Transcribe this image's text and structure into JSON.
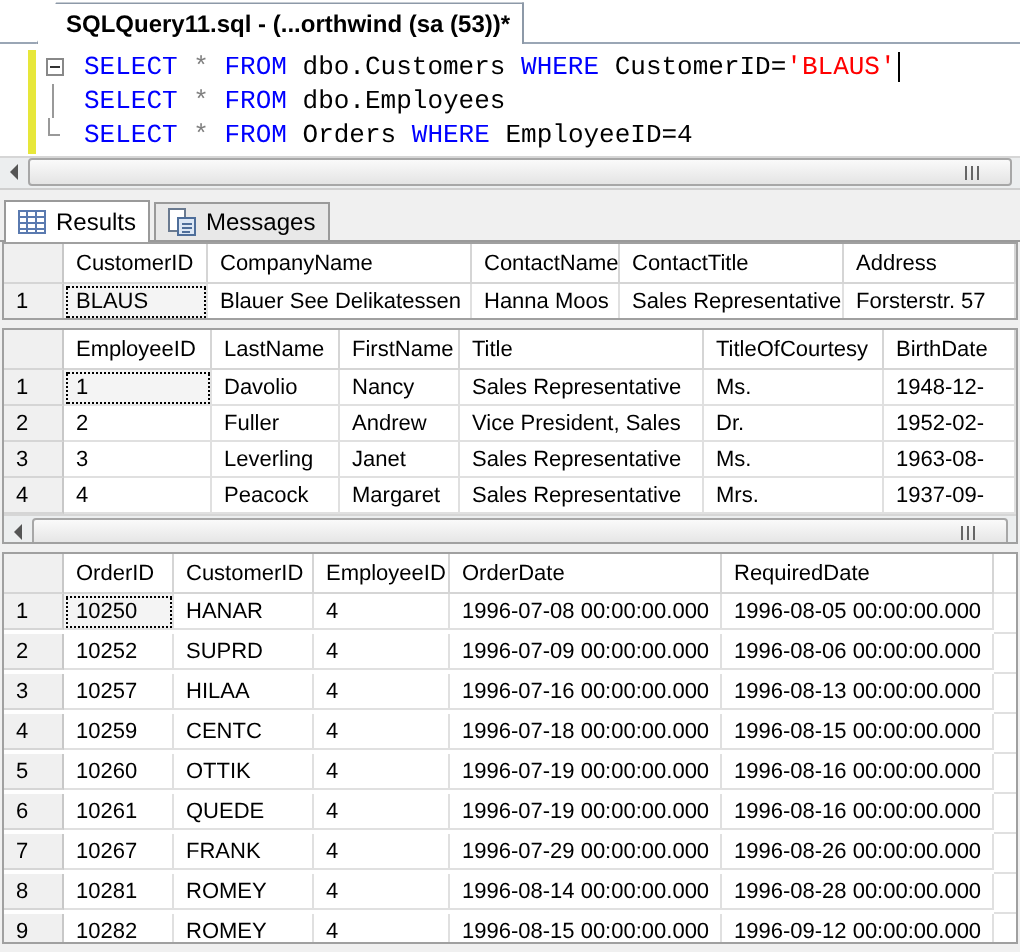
{
  "editor": {
    "tab": {
      "title": "SQLQuery11.sql - (...orthwind (sa (53))*",
      "selected": true
    },
    "lines": [
      {
        "tokens": [
          {
            "kind": "keyword",
            "text": "SELECT"
          },
          {
            "kind": "operator",
            "text": "*"
          },
          {
            "kind": "keyword",
            "text": "FROM"
          },
          {
            "kind": "plain",
            "text": "dbo.Customers"
          },
          {
            "kind": "keyword",
            "text": "WHERE"
          },
          {
            "kind": "plain",
            "text": "CustomerID="
          },
          {
            "kind": "string",
            "text": "'BLAUS'",
            "spaced": false
          }
        ],
        "caret": true
      },
      {
        "tokens": [
          {
            "kind": "keyword",
            "text": "SELECT"
          },
          {
            "kind": "operator",
            "text": "*"
          },
          {
            "kind": "keyword",
            "text": "FROM"
          },
          {
            "kind": "plain",
            "text": "dbo.Employees"
          }
        ],
        "caret": false
      },
      {
        "tokens": [
          {
            "kind": "keyword",
            "text": "SELECT"
          },
          {
            "kind": "operator",
            "text": "*"
          },
          {
            "kind": "keyword",
            "text": "FROM"
          },
          {
            "kind": "plain",
            "text": "Orders"
          },
          {
            "kind": "keyword",
            "text": "WHERE"
          },
          {
            "kind": "plain",
            "text": "EmployeeID=4"
          }
        ],
        "caret": false
      }
    ]
  },
  "result_tabs": [
    {
      "label": "Results",
      "selected": true,
      "kind": "grid"
    },
    {
      "label": "Messages",
      "selected": false,
      "kind": "messages"
    }
  ],
  "grids": [
    {
      "columns": [
        "CustomerID",
        "CompanyName",
        "ContactName",
        "ContactTitle",
        "Address"
      ],
      "scrollbar": false,
      "rows": [
        {
          "number": "1",
          "focused": true,
          "cells": [
            "BLAUS",
            "Blauer See Delikatessen",
            "Hanna Moos",
            "Sales Representative",
            "Forsterstr. 57"
          ]
        }
      ]
    },
    {
      "columns": [
        "EmployeeID",
        "LastName",
        "FirstName",
        "Title",
        "TitleOfCourtesy",
        "BirthDate"
      ],
      "scrollbar": true,
      "rows": [
        {
          "number": "1",
          "focused": true,
          "cells": [
            "1",
            "Davolio",
            "Nancy",
            "Sales Representative",
            "Ms.",
            "1948-12-"
          ]
        },
        {
          "number": "2",
          "focused": false,
          "cells": [
            "2",
            "Fuller",
            "Andrew",
            "Vice President, Sales",
            "Dr.",
            "1952-02-"
          ]
        },
        {
          "number": "3",
          "focused": false,
          "cells": [
            "3",
            "Leverling",
            "Janet",
            "Sales Representative",
            "Ms.",
            "1963-08-"
          ]
        },
        {
          "number": "4",
          "focused": false,
          "cells": [
            "4",
            "Peacock",
            "Margaret",
            "Sales Representative",
            "Mrs.",
            "1937-09-"
          ]
        }
      ]
    },
    {
      "columns": [
        "OrderID",
        "CustomerID",
        "EmployeeID",
        "OrderDate",
        "RequiredDate"
      ],
      "scrollbar": false,
      "rows": [
        {
          "number": "1",
          "focused": true,
          "cells": [
            "10250",
            "HANAR",
            "4",
            "1996-07-08 00:00:00.000",
            "1996-08-05 00:00:00.000"
          ]
        },
        {
          "number": "2",
          "focused": false,
          "cells": [
            "10252",
            "SUPRD",
            "4",
            "1996-07-09 00:00:00.000",
            "1996-08-06 00:00:00.000"
          ]
        },
        {
          "number": "3",
          "focused": false,
          "cells": [
            "10257",
            "HILAA",
            "4",
            "1996-07-16 00:00:00.000",
            "1996-08-13 00:00:00.000"
          ]
        },
        {
          "number": "4",
          "focused": false,
          "cells": [
            "10259",
            "CENTC",
            "4",
            "1996-07-18 00:00:00.000",
            "1996-08-15 00:00:00.000"
          ]
        },
        {
          "number": "5",
          "focused": false,
          "cells": [
            "10260",
            "OTTIK",
            "4",
            "1996-07-19 00:00:00.000",
            "1996-08-16 00:00:00.000"
          ]
        },
        {
          "number": "6",
          "focused": false,
          "cells": [
            "10261",
            "QUEDE",
            "4",
            "1996-07-19 00:00:00.000",
            "1996-08-16 00:00:00.000"
          ]
        },
        {
          "number": "7",
          "focused": false,
          "cells": [
            "10267",
            "FRANK",
            "4",
            "1996-07-29 00:00:00.000",
            "1996-08-26 00:00:00.000"
          ]
        },
        {
          "number": "8",
          "focused": false,
          "cells": [
            "10281",
            "ROMEY",
            "4",
            "1996-08-14 00:00:00.000",
            "1996-08-28 00:00:00.000"
          ]
        },
        {
          "number": "9",
          "focused": false,
          "cells": [
            "10282",
            "ROMEY",
            "4",
            "1996-08-15 00:00:00.000",
            "1996-09-12 00:00:00.000"
          ]
        }
      ]
    }
  ]
}
